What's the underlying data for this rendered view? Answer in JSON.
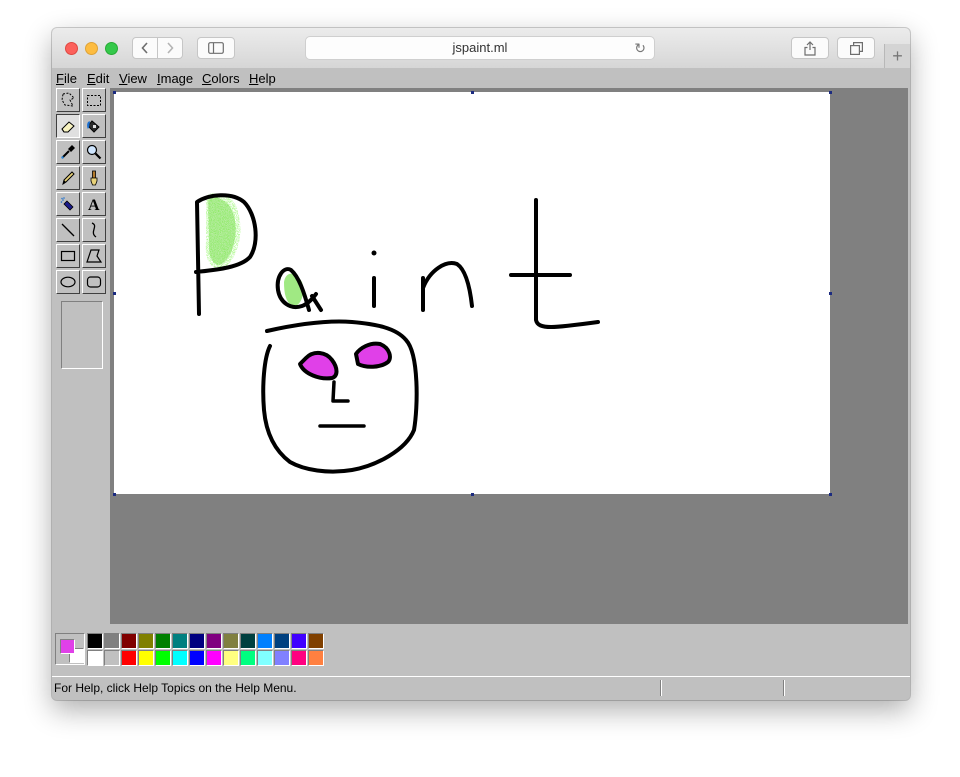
{
  "browser": {
    "url": "jspaint.ml"
  },
  "menu": [
    {
      "key": "F",
      "rest": "ile"
    },
    {
      "key": "E",
      "rest": "dit"
    },
    {
      "key": "V",
      "rest": "iew"
    },
    {
      "key": "I",
      "rest": "mage"
    },
    {
      "key": "C",
      "rest": "olors"
    },
    {
      "key": "H",
      "rest": "elp"
    }
  ],
  "tools": [
    {
      "name": "free-form-select",
      "icon": "free-form-select-icon",
      "pressed": false
    },
    {
      "name": "select",
      "icon": "select-icon",
      "pressed": false
    },
    {
      "name": "eraser",
      "icon": "eraser-icon",
      "pressed": true
    },
    {
      "name": "fill-with-color",
      "icon": "fill-bucket-icon",
      "pressed": false
    },
    {
      "name": "pick-color",
      "icon": "eyedropper-icon",
      "pressed": false
    },
    {
      "name": "magnifier",
      "icon": "magnifier-icon",
      "pressed": false
    },
    {
      "name": "pencil",
      "icon": "pencil-icon",
      "pressed": false
    },
    {
      "name": "brush",
      "icon": "brush-icon",
      "pressed": false
    },
    {
      "name": "airbrush",
      "icon": "airbrush-icon",
      "pressed": false
    },
    {
      "name": "text",
      "icon": "text-icon",
      "pressed": false
    },
    {
      "name": "line",
      "icon": "line-icon",
      "pressed": false
    },
    {
      "name": "curve",
      "icon": "curve-icon",
      "pressed": false
    },
    {
      "name": "rectangle",
      "icon": "rectangle-icon",
      "pressed": false
    },
    {
      "name": "polygon",
      "icon": "polygon-icon",
      "pressed": false
    },
    {
      "name": "ellipse",
      "icon": "ellipse-icon",
      "pressed": false
    },
    {
      "name": "rounded-rectangle",
      "icon": "rounded-rectangle-icon",
      "pressed": false
    }
  ],
  "current_colors": {
    "foreground": "#e040e8",
    "background": "#ffffff"
  },
  "palette": {
    "row1": [
      "#000000",
      "#808080",
      "#800000",
      "#808000",
      "#008000",
      "#008080",
      "#000080",
      "#800080",
      "#808040",
      "#004040",
      "#0080ff",
      "#004080",
      "#4000ff",
      "#804000"
    ],
    "row2": [
      "#ffffff",
      "#c0c0c0",
      "#ff0000",
      "#ffff00",
      "#00ff00",
      "#00ffff",
      "#0000ff",
      "#ff00ff",
      "#ffff80",
      "#00ff80",
      "#80ffff",
      "#8080ff",
      "#ff0080",
      "#ff8040"
    ]
  },
  "status": {
    "help": "For Help, click Help Topics on the Help Menu."
  }
}
